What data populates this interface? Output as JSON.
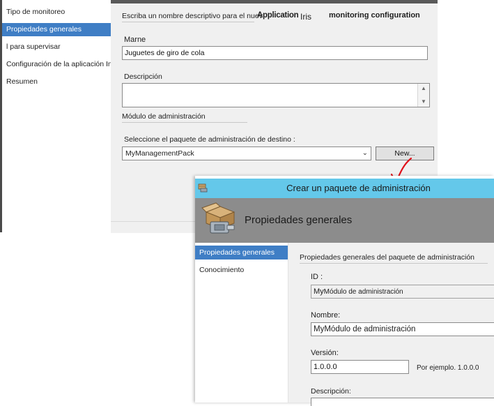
{
  "wizard": {
    "nav": [
      {
        "label": "Tipo de monitoreo",
        "active": false
      },
      {
        "label": "Propiedades generales",
        "active": true
      },
      {
        "label": "l para supervisar",
        "active": false
      },
      {
        "label": "Configuración de la aplicación Insights",
        "active": false
      },
      {
        "label": "Resumen",
        "active": false
      }
    ],
    "header_text": "Escriba un nombre descriptivo para el nuev",
    "overlay_application": "Application",
    "overlay_iris": "Iris",
    "overlay_monitoring": "monitoring configuration",
    "name_label": "Marne",
    "name_value": "Juguetes de giro de cola",
    "description_label": "Descripción",
    "description_value": "",
    "mp_section_header": "Módulo de administración",
    "mp_select_label": "Seleccione el paquete de administración de destino :",
    "mp_selected": "MyManagementPack",
    "new_button": "New..."
  },
  "dialog": {
    "title": "Crear un paquete de administración",
    "banner_title": "Propiedades generales",
    "nav": [
      {
        "label": "Propiedades generales",
        "active": true
      },
      {
        "label": "Conocimiento",
        "active": false
      }
    ],
    "section_header": "Propiedades generales del paquete de administración",
    "id_label": "ID :",
    "id_value_prefix": "My",
    "id_value": "Módulo de administración",
    "name_label": "Nombre:",
    "name_value_prefix": "My",
    "name_value": "Módulo de administración",
    "version_label": "Versión:",
    "version_value": "1.0.0.0",
    "version_hint": "Por ejemplo. 1.0.0.0",
    "description_label": "Descripción:"
  },
  "colors": {
    "nav_active": "#3f7ec5",
    "dialog_titlebar": "#64c8ea",
    "dialog_banner": "#8c8c8c",
    "content_bg": "#f0f0f0",
    "arrow": "#e0101a"
  }
}
